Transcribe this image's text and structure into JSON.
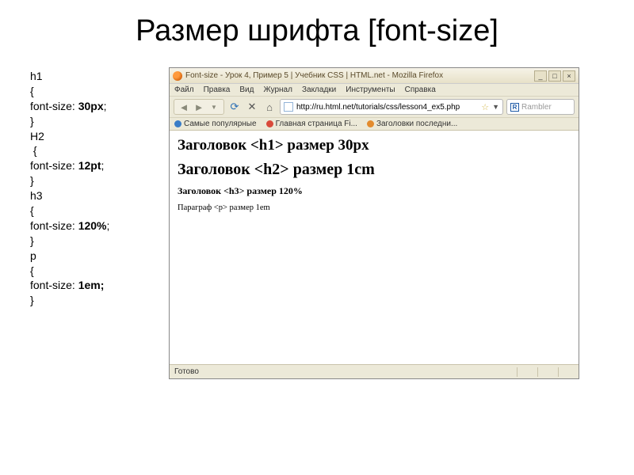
{
  "slide": {
    "title": "Размер шрифта [font-size]"
  },
  "code": {
    "h1_sel": "h1",
    "h1_prop": "font-size: ",
    "h1_val": "30px",
    "h2_sel": "H2",
    "h2_prop": "font-size: ",
    "h2_val": "12pt",
    "h3_sel": "h3",
    "h3_prop": "font-size: ",
    "h3_val": "120%",
    "p_sel": "p",
    "p_prop": "font-size: ",
    "p_val": "1em;",
    "open": "{",
    "close": "}",
    "semi": ";"
  },
  "browser": {
    "title": "Font-size - Урок 4, Пример 5 | Учебник CSS | HTML.net - Mozilla Firefox",
    "menu": {
      "file": "Файл",
      "edit": "Правка",
      "view": "Вид",
      "history": "Журнал",
      "bookmarks": "Закладки",
      "tools": "Инструменты",
      "help": "Справка"
    },
    "url": "http://ru.html.net/tutorials/css/lesson4_ex5.php",
    "search_placeholder": "Rambler",
    "bookmarks_bar": {
      "popular": "Самые популярные",
      "fi": "Главная страница Fi...",
      "last": "Заголовки последни..."
    },
    "page": {
      "h1": "Заголовок <h1> размер 30px",
      "h2": "Заголовок <h2> размер 1cm",
      "h3": "Заголовок <h3> размер 120%",
      "p": "Параграф <p> размер 1em"
    },
    "status": "Готово"
  }
}
